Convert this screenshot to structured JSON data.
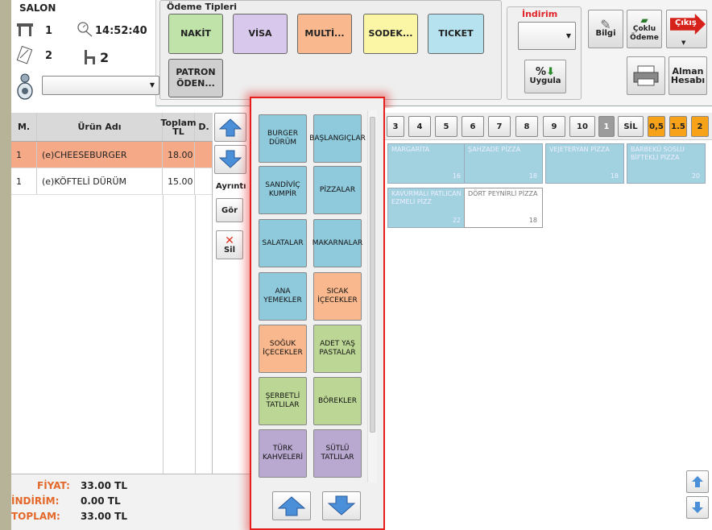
{
  "info": {
    "title": "SALON",
    "table_no": "1",
    "time": "14:52:40",
    "guests": "2",
    "chairs": "2",
    "waiter_value": ""
  },
  "payment": {
    "title": "Ödeme Tipleri",
    "buttons": [
      {
        "label": "NAKİT",
        "color": "#bfe3a8"
      },
      {
        "label": "VİSA",
        "color": "#d8c8ec"
      },
      {
        "label": "MULTİ...",
        "color": "#f9b88d"
      },
      {
        "label": "SODEK...",
        "color": "#fbf6a5"
      },
      {
        "label": "TICKET",
        "color": "#b6e1ee"
      },
      {
        "label": "PATRON ÖDEN...",
        "color": "#cfcfcf"
      }
    ]
  },
  "discount": {
    "title": "İndirim",
    "apply_label": "Uygula",
    "value": ""
  },
  "tools": {
    "info_label": "Bilgi",
    "multi_pay_label": "Çoklu Ödeme",
    "exit_label": "Çıkış",
    "take_bill_label": "Alman Hesabı"
  },
  "order_table": {
    "headers": [
      "M.",
      "Ürün Adı",
      "Toplam TL",
      "D."
    ],
    "rows": [
      {
        "qty": "1",
        "name": "(e)CHEESEBURGER",
        "total": "18.00",
        "d": ""
      },
      {
        "qty": "1",
        "name": "(e)KÖFTELİ DÜRÜM",
        "total": "15.00",
        "d": ""
      }
    ],
    "details_label": "Ayrıntı",
    "view_label": "Gör",
    "delete_label": "Sil"
  },
  "totals": {
    "price_label": "FİYAT:",
    "price": "33.00 TL",
    "discount_label": "İNDİRİM:",
    "discount": "0.00 TL",
    "total_label": "TOPLAM:",
    "total": "33.00 TL"
  },
  "categories": [
    {
      "label": "BURGER DÜRÜM",
      "color": "blue"
    },
    {
      "label": "BAŞLANGIÇLAR",
      "color": "blue"
    },
    {
      "label": "SANDİVİÇ KUMPİR",
      "color": "blue"
    },
    {
      "label": "PİZZALAR",
      "color": "blue"
    },
    {
      "label": "SALATALAR",
      "color": "blue"
    },
    {
      "label": "MAKARNALAR",
      "color": "blue"
    },
    {
      "label": "ANA YEMEKLER",
      "color": "blue"
    },
    {
      "label": "SICAK İÇECEKLER",
      "color": "orange"
    },
    {
      "label": "SOĞUK İÇECEKLER",
      "color": "orange"
    },
    {
      "label": "ADET YAŞ PASTALAR",
      "color": "green"
    },
    {
      "label": "ŞERBETLİ TATLILAR",
      "color": "green"
    },
    {
      "label": "BÖREKLER",
      "color": "green"
    },
    {
      "label": "TÜRK KAHVELERİ",
      "color": "purple"
    },
    {
      "label": "SÜTLÜ TATLILAR",
      "color": "purple"
    }
  ],
  "pages": [
    "3",
    "4",
    "5",
    "6",
    "7",
    "8",
    "9",
    "10",
    "1",
    "SİL",
    "0,5",
    "1.5",
    "2"
  ],
  "products": [
    {
      "name": "MARGARİTA",
      "qty": "16",
      "selected": false
    },
    {
      "name": "ŞAHZADE PİZZA",
      "qty": "18",
      "selected": false
    },
    {
      "name": "VEJETERYAN PİZZA",
      "qty": "18",
      "selected": false
    },
    {
      "name": "BARBEKÜ SOSLU BİFTEKLİ PİZZA",
      "qty": "20",
      "selected": false
    },
    {
      "name": "KAVURMALI PATLICAN EZMELİ PİZZ",
      "qty": "22",
      "selected": false
    },
    {
      "name": "DÖRT PEYNİRLİ PİZZA",
      "qty": "18",
      "selected": true
    }
  ]
}
